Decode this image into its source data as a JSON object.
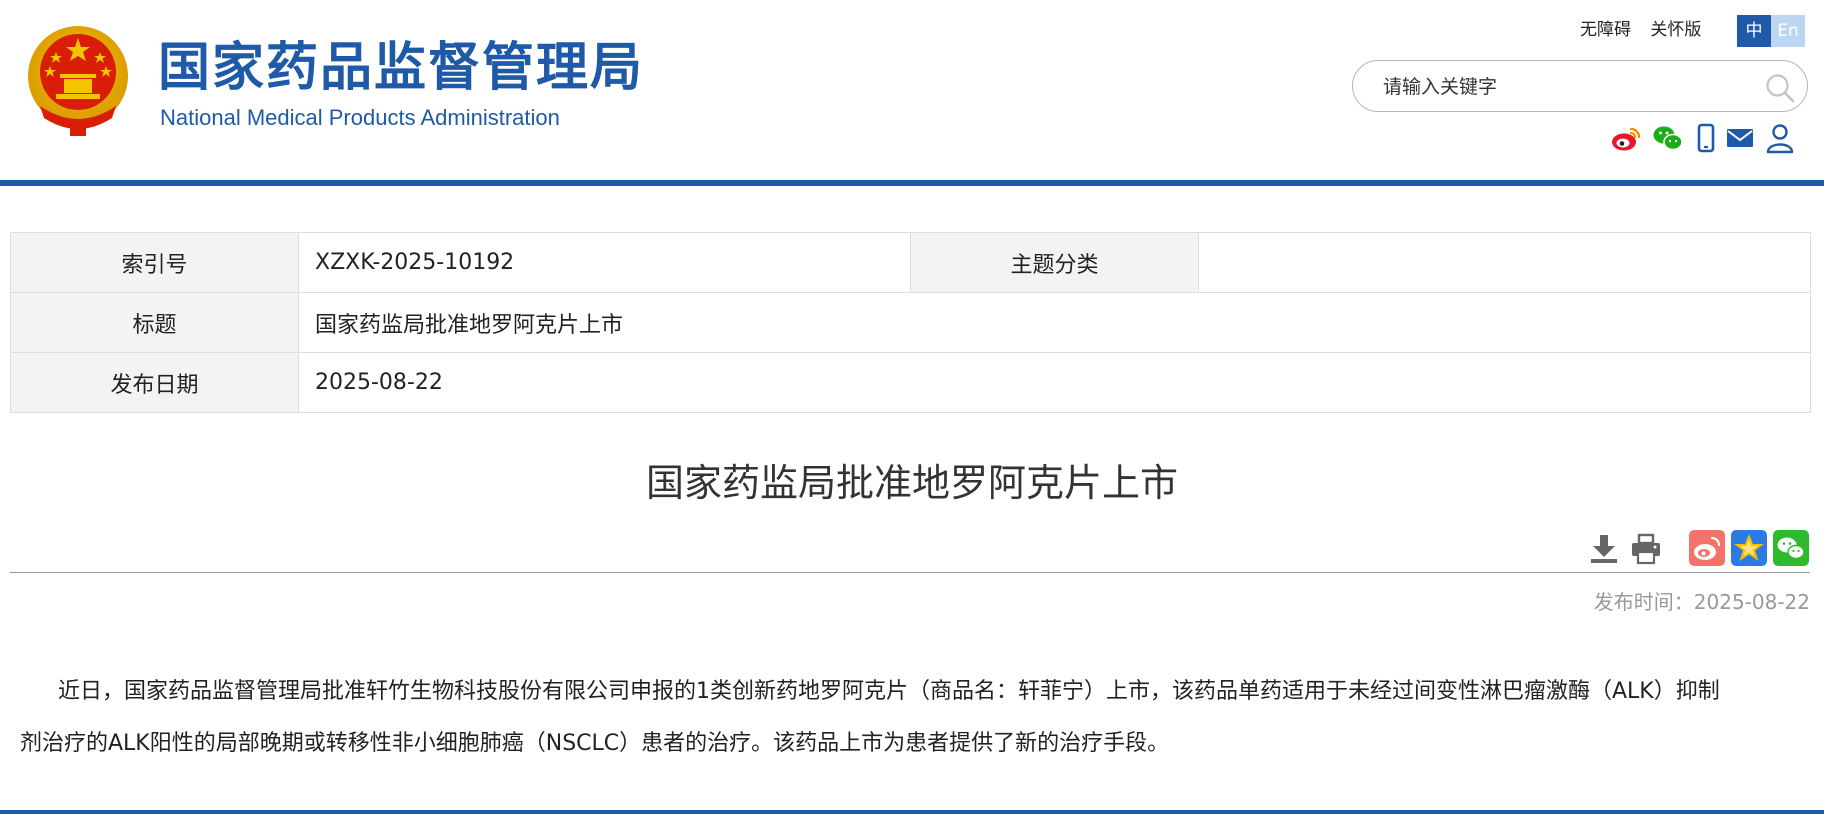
{
  "header": {
    "site_name_cn": "国家药品监督管理局",
    "site_name_en": "National Medical Products Administration",
    "top_links": [
      "无障碍",
      "关怀版"
    ],
    "lang": {
      "zh": "中",
      "en": "En"
    },
    "search": {
      "placeholder": "请输入关键字"
    },
    "social_icons": [
      "weibo-icon",
      "wechat-icon",
      "mobile-icon",
      "mail-icon",
      "user-icon"
    ]
  },
  "info": {
    "index_label": "索引号",
    "index_value": "XZXK-2025-10192",
    "topic_label": "主题分类",
    "topic_value": "",
    "title_label": "标题",
    "title_value": "国家药监局批准地罗阿克片上市",
    "date_label": "发布日期",
    "date_value": "2025-08-22"
  },
  "article": {
    "title": "国家药监局批准地罗阿克片上市",
    "tools": [
      "download-icon",
      "print-icon"
    ],
    "share": [
      "weibo-share-icon",
      "favorite-share-icon",
      "wechat-share-icon"
    ],
    "pub_time_label": "发布时间：",
    "pub_time_value": "2025-08-22",
    "body": "近日，国家药品监督管理局批准轩竹生物科技股份有限公司申报的1类创新药地罗阿克片（商品名：轩菲宁）上市，该药品单药适用于未经过间变性淋巴瘤激酶（ALK）抑制剂治疗的ALK阳性的局部晚期或转移性非小细胞肺癌（NSCLC）患者的治疗。该药品上市为患者提供了新的治疗手段。"
  },
  "colors": {
    "brand_blue": "#1f5aa8",
    "weibo_red": "#e6162d",
    "wechat_green": "#1aad19",
    "star_gold": "#f6c000"
  }
}
